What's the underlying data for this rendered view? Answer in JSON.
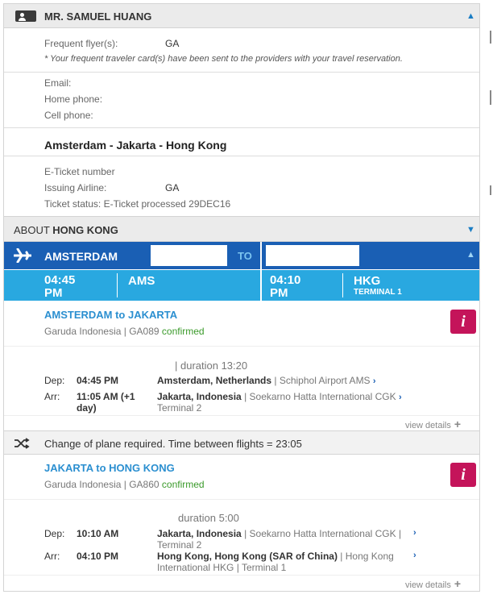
{
  "passenger": {
    "name": "MR. SAMUEL HUANG",
    "ff_label": "Frequent flyer(s):",
    "ff_value": "GA",
    "ff_note": "* Your frequent traveler card(s) have been sent to the providers with your travel reservation.",
    "email_label": "Email:",
    "home_label": "Home phone:",
    "cell_label": "Cell phone:"
  },
  "trip": {
    "route": "Amsterdam - Jakarta - Hong Kong",
    "eticket_label": "E-Ticket number",
    "airline_label": "Issuing Airline:",
    "airline_value": "GA",
    "status": "Ticket status: E-Ticket processed 29DEC16"
  },
  "about": {
    "prefix": "ABOUT",
    "city": "HONG KONG"
  },
  "summary": {
    "from_city": "AMSTERDAM",
    "to_label": "TO",
    "dep_time": "04:45",
    "dep_ampm": "PM",
    "dep_code": "AMS",
    "arr_time": "04:10",
    "arr_ampm": "PM",
    "arr_code": "HKG",
    "arr_terminal": "TERMINAL 1"
  },
  "flight1": {
    "title": "AMSTERDAM to JAKARTA",
    "airline": "Garuda Indonesia |",
    "number": "GA089",
    "status": "confirmed",
    "duration": "| duration 13:20",
    "dep_label": "Dep:",
    "dep_time": "04:45 PM",
    "dep_place": "Amsterdam, Netherlands",
    "dep_airport": "| Schiphol Airport AMS",
    "arr_label": "Arr:",
    "arr_time": "11:05 AM (+1 day)",
    "arr_place": "Jakarta, Indonesia",
    "arr_airport": "| Soekarno Hatta International CGK",
    "arr_terminal": "Terminal 2",
    "view": "view details"
  },
  "change": {
    "text": "Change of plane required. Time between flights = 23:05"
  },
  "flight2": {
    "title": "JAKARTA to HONG KONG",
    "airline": "Garuda Indonesia |",
    "number": "GA860",
    "status": "confirmed",
    "duration": "duration 5:00",
    "dep_label": "Dep:",
    "dep_time": "10:10 AM",
    "dep_place": "Jakarta, Indonesia",
    "dep_airport": "| Soekarno Hatta International CGK |",
    "dep_terminal": "Terminal 2",
    "arr_label": "Arr:",
    "arr_time": "04:10 PM",
    "arr_place": "Hong Kong, Hong Kong (SAR of China)",
    "arr_airport": "| Hong Kong",
    "arr_airport2": "International HKG",
    "arr_terminal": "| Terminal 1",
    "view": "view details"
  },
  "colors": {
    "accent": "#1a5fb4",
    "light": "#29a8e0",
    "info": "#c4145a",
    "confirmed": "#3a9a2a"
  },
  "icons": [
    "person-card-icon",
    "plane-icon",
    "shuffle-icon",
    "info-icon",
    "chevron-up-icon",
    "chevron-down-icon",
    "chevron-right-icon",
    "plus-icon"
  ]
}
